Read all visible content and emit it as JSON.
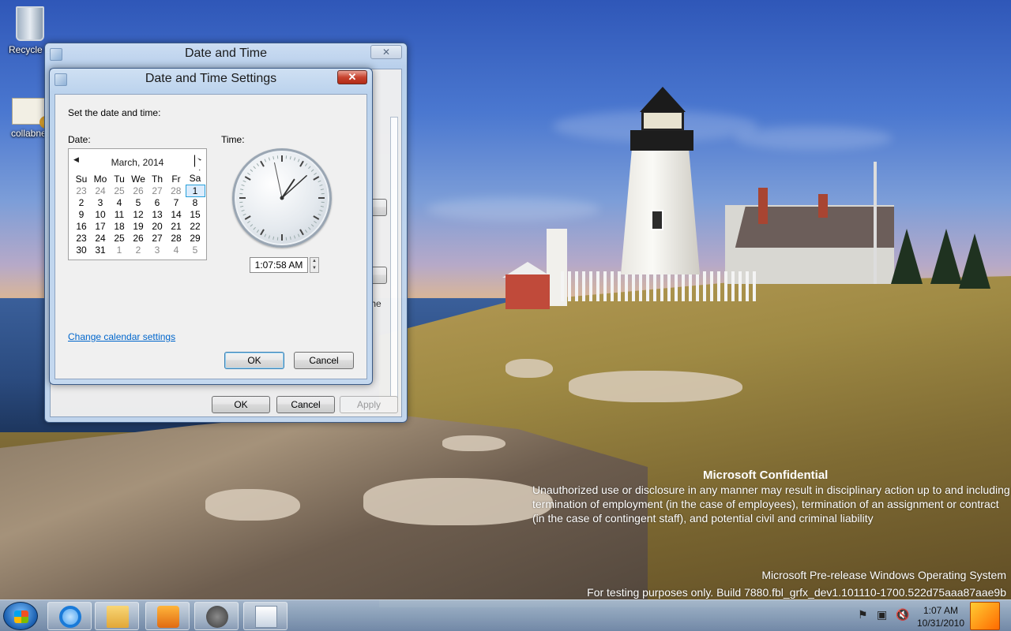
{
  "desktop": {
    "icons": [
      {
        "label": "Recycle B"
      },
      {
        "label": "collabnet"
      }
    ],
    "watermark": {
      "title": "Microsoft Confidential",
      "body": "Unauthorized use or disclosure in any manner may result in disciplinary action up to and including termination of employment (in the case of employees), termination of an assignment or contract (in the case of contingent staff), and potential civil and criminal liability",
      "build_line1": "Microsoft Pre-release Windows Operating System",
      "build_line2": "For testing purposes only. Build 7880.fbl_grfx_dev1.101110-1700.522d75aaa87aae9b"
    }
  },
  "outer_window": {
    "title": "Date and Time",
    "close_label": "✕",
    "partial_text": "The",
    "ok": "OK",
    "cancel": "Cancel",
    "apply": "Apply"
  },
  "settings_dialog": {
    "title": "Date and Time Settings",
    "close_label": "✕",
    "instruction": "Set the date and time:",
    "date_label": "Date:",
    "time_label": "Time:",
    "calendar": {
      "month": "March, 2014",
      "prev_label": "◀",
      "next_label": "▶",
      "day_headers": [
        "Su",
        "Mo",
        "Tu",
        "We",
        "Th",
        "Fr",
        "Sa"
      ],
      "weeks": [
        [
          "23",
          "24",
          "25",
          "26",
          "27",
          "28",
          "1"
        ],
        [
          "2",
          "3",
          "4",
          "5",
          "6",
          "7",
          "8"
        ],
        [
          "9",
          "10",
          "11",
          "12",
          "13",
          "14",
          "15"
        ],
        [
          "16",
          "17",
          "18",
          "19",
          "20",
          "21",
          "22"
        ],
        [
          "23",
          "24",
          "25",
          "26",
          "27",
          "28",
          "29"
        ],
        [
          "30",
          "31",
          "1",
          "2",
          "3",
          "4",
          "5"
        ]
      ],
      "selected": "1"
    },
    "clock": {
      "hour": 1,
      "minute": 7,
      "second": 58
    },
    "time_value": "1:07:58 AM",
    "change_calendar_link": "Change calendar settings",
    "ok": "OK",
    "cancel": "Cancel"
  },
  "taskbar": {
    "apps": [
      "internet-explorer",
      "windows-explorer",
      "media-center",
      "raccoon-app",
      "date-and-time"
    ],
    "time": "1:07 AM",
    "date": "10/31/2010"
  }
}
